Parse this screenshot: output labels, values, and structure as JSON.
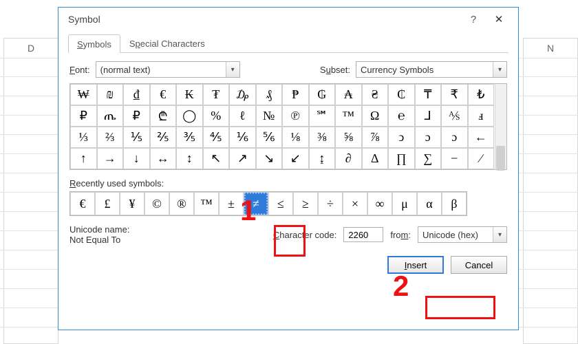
{
  "bg": {
    "colD": "D",
    "colN": "N"
  },
  "dialog": {
    "title": "Symbol",
    "help": "?",
    "close": "✕",
    "tabs": {
      "symbols": "Symbols",
      "special": "Special Characters"
    },
    "fontLabel": "Font:",
    "fontValue": "(normal text)",
    "subsetLabel": "Subset:",
    "subsetValue": "Currency Symbols",
    "grid": [
      "₩",
      "₪",
      "₫",
      "€",
      "₭",
      "₮",
      "₯",
      "₰",
      "₱",
      "₲",
      "₳",
      "₴",
      "₵",
      "₸",
      "₹",
      "₺",
      "₽",
      "ጤ",
      "₽",
      "₾",
      "◯",
      "%",
      "ℓ",
      "№",
      "℗",
      "℠",
      "™",
      "Ω",
      "℮",
      "⅃",
      "⅍",
      "ⅎ",
      "⅓",
      "⅔",
      "⅕",
      "⅖",
      "⅗",
      "⅘",
      "⅙",
      "⅚",
      "⅛",
      "⅜",
      "⅝",
      "⅞",
      "ↄ",
      "ɔ",
      "ɔ",
      "←",
      "↑",
      "→",
      "↓",
      "↔",
      "↕",
      "↖",
      "↗",
      "↘",
      "↙",
      "↨",
      "∂",
      "∆",
      "∏",
      "∑",
      "−",
      "∕"
    ],
    "recentLabel": "Recently used symbols:",
    "recent": [
      "€",
      "£",
      "¥",
      "©",
      "®",
      "™",
      "±",
      "≠",
      "≤",
      "≥",
      "÷",
      "×",
      "∞",
      "μ",
      "α",
      "β"
    ],
    "recentSelectedIndex": 7,
    "unicodeNameLabel": "Unicode name:",
    "unicodeName": "Not Equal To",
    "charCodeLabel": "Character code:",
    "charCode": "2260",
    "fromLabel": "from:",
    "fromValue": "Unicode (hex)",
    "insert": "Insert",
    "cancel": "Cancel"
  },
  "annot": {
    "one": "1",
    "two": "2"
  }
}
